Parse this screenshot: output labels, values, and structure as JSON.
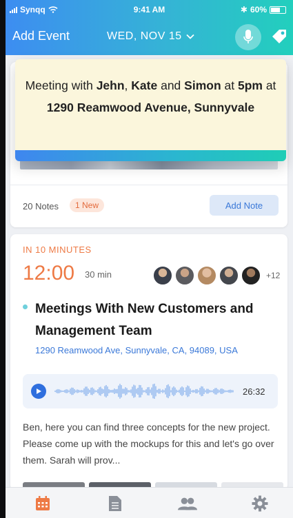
{
  "status_bar": {
    "carrier": "Synqq",
    "time": "9:41 AM",
    "battery": "60%"
  },
  "header": {
    "title": "Add Event",
    "date": "WED, NOV 15"
  },
  "popup": {
    "segments": [
      {
        "text": "Meeting with ",
        "bold": false
      },
      {
        "text": "Jehn",
        "bold": true
      },
      {
        "text": ", ",
        "bold": false
      },
      {
        "text": "Kate",
        "bold": true
      },
      {
        "text": " and ",
        "bold": false
      },
      {
        "text": "Simon",
        "bold": true
      },
      {
        "text": " at ",
        "bold": false
      },
      {
        "text": "5pm",
        "bold": true
      },
      {
        "text": " at ",
        "bold": false
      },
      {
        "text": "1290 Reamwood Avenue, Sunnyvale",
        "bold": true
      }
    ]
  },
  "notes": {
    "count_label": "20 Notes",
    "new_badge": "1 New",
    "add_label": "Add Note"
  },
  "event": {
    "relative_time": "IN 10 MINUTES",
    "start_time": "12:00",
    "duration": "30 min",
    "more_attendees": "+12",
    "title": "Meetings With New Customers and Management Team",
    "address": "1290 Reamwood Ave, Sunnyvale, CA, 94089, USA",
    "audio_duration": "26:32",
    "description": "Ben, here you can find three concepts for the new project. Please come up with the mockups for this and let's go over them. Sarah will prov..."
  },
  "colors": {
    "accent_orange": "#ee7a45",
    "link_blue": "#3a78d8",
    "header_start": "#3d8df1",
    "header_end": "#22cfbd"
  },
  "tabs": [
    {
      "icon": "calendar-icon",
      "active": true
    },
    {
      "icon": "document-icon",
      "active": false
    },
    {
      "icon": "people-icon",
      "active": false
    },
    {
      "icon": "gear-icon",
      "active": false
    }
  ]
}
